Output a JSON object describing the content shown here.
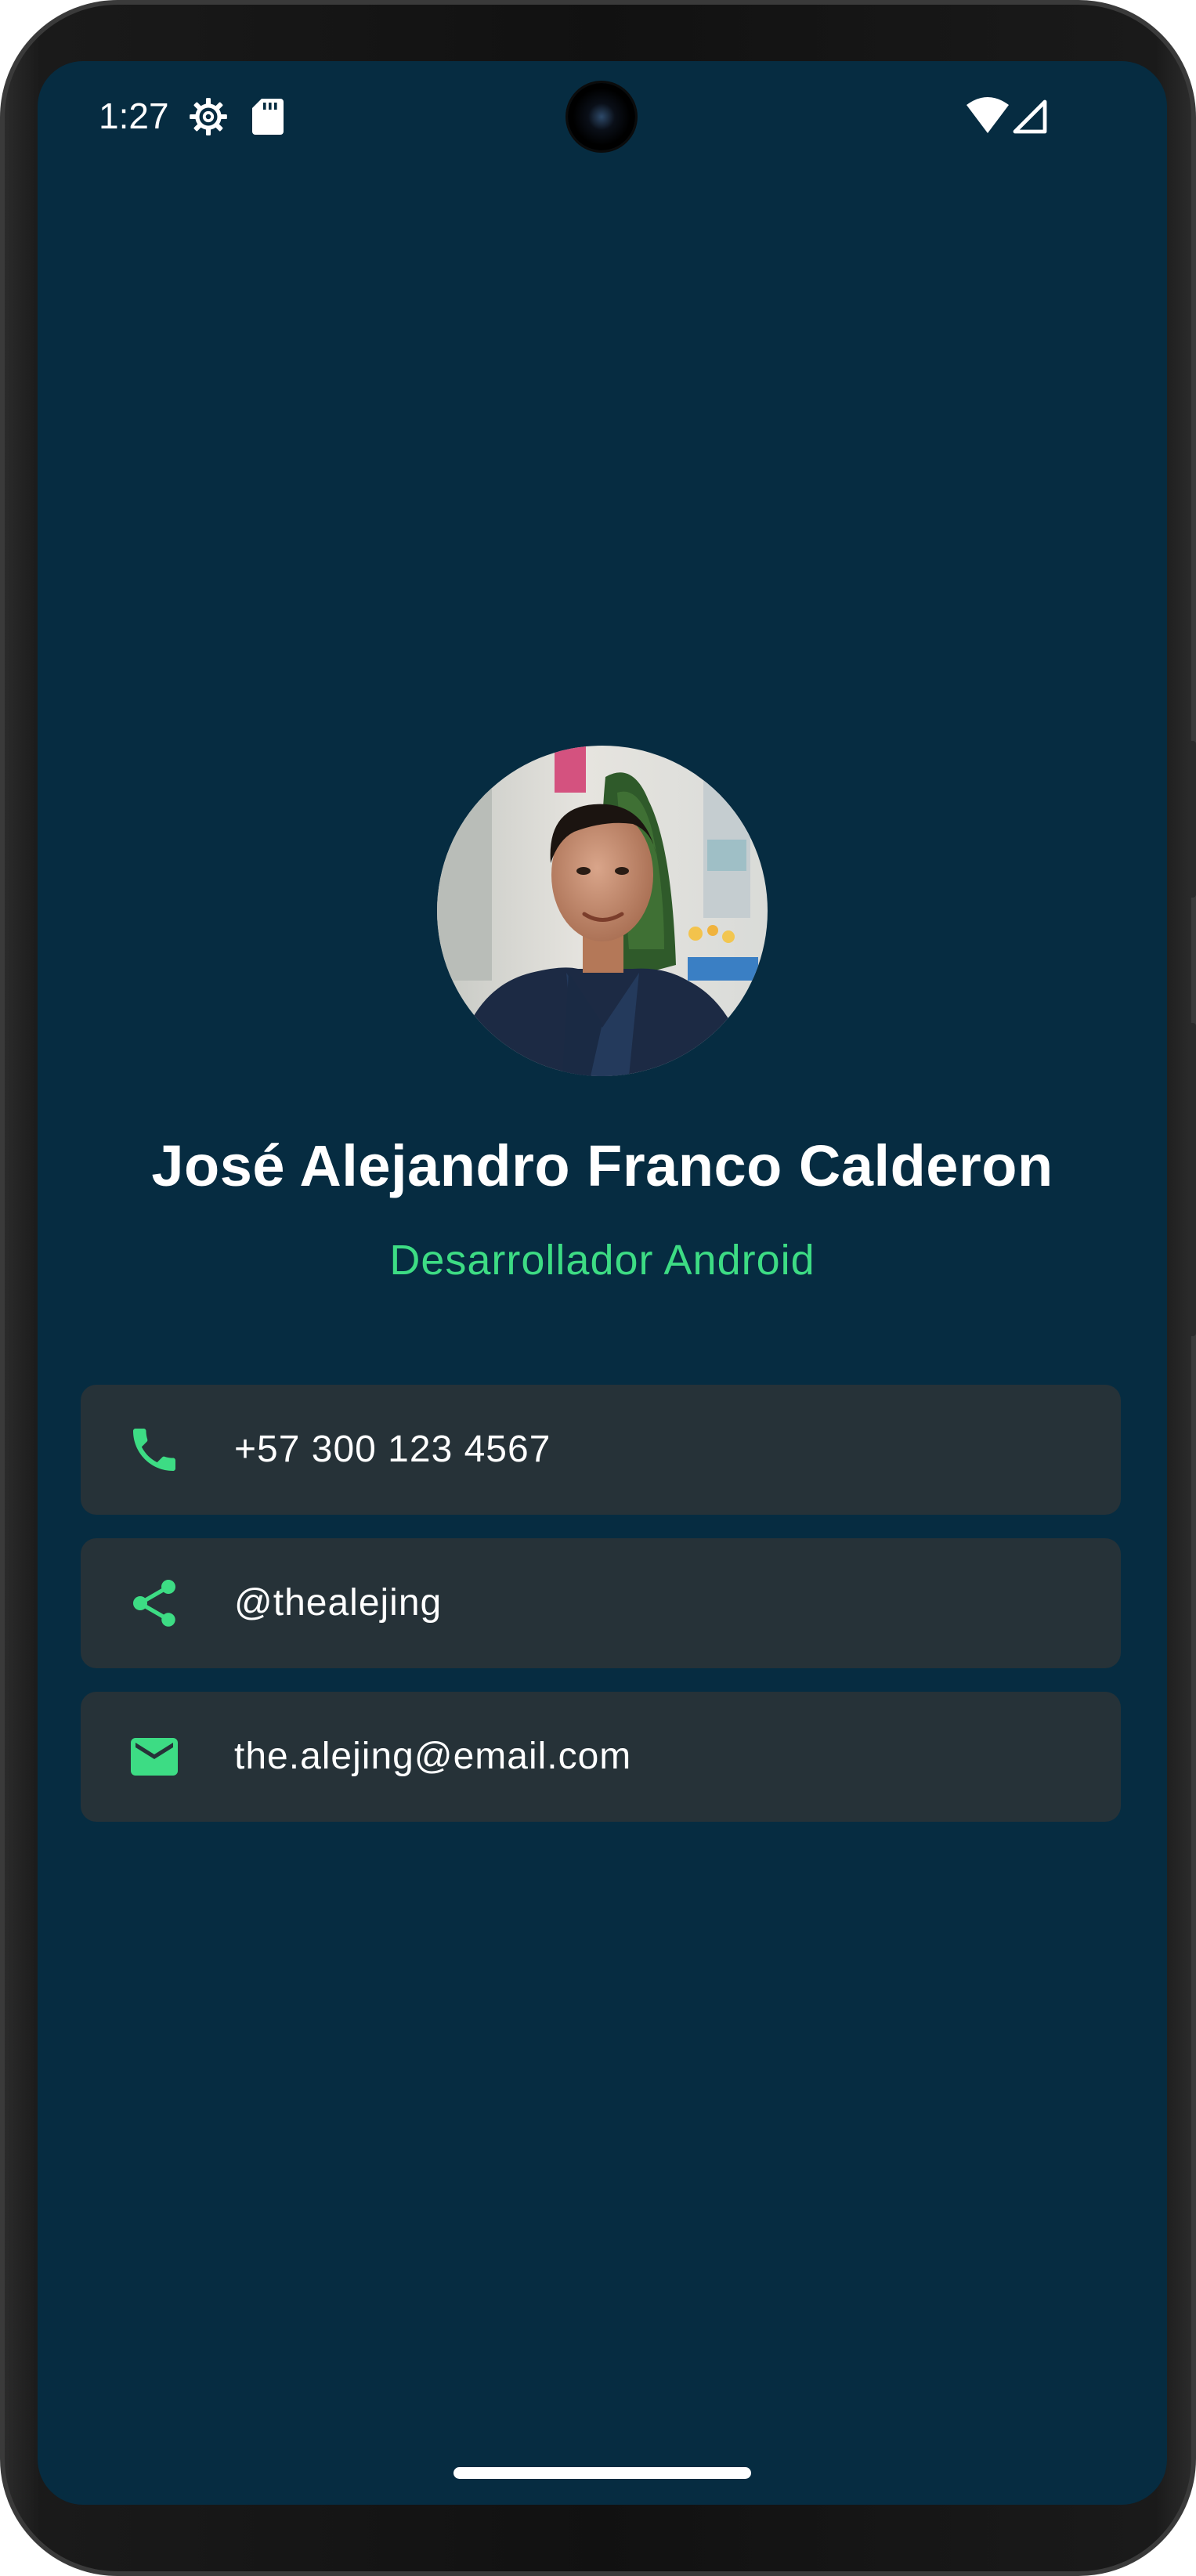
{
  "status_bar": {
    "time": "1:27",
    "icons": [
      "settings-gear-icon",
      "sd-card-icon",
      "wifi-icon",
      "cell-signal-icon"
    ]
  },
  "profile": {
    "name": "José Alejandro Franco Calderon",
    "role": "Desarrollador Android"
  },
  "contacts": [
    {
      "icon": "phone-icon",
      "label": "+57 300 123 4567"
    },
    {
      "icon": "share-icon",
      "label": "@thealejing"
    },
    {
      "icon": "email-icon",
      "label": "the.alejing@email.com"
    }
  ],
  "colors": {
    "background": "#062c41",
    "card": "#263238",
    "accent": "#3ddc84",
    "text": "#ffffff"
  }
}
